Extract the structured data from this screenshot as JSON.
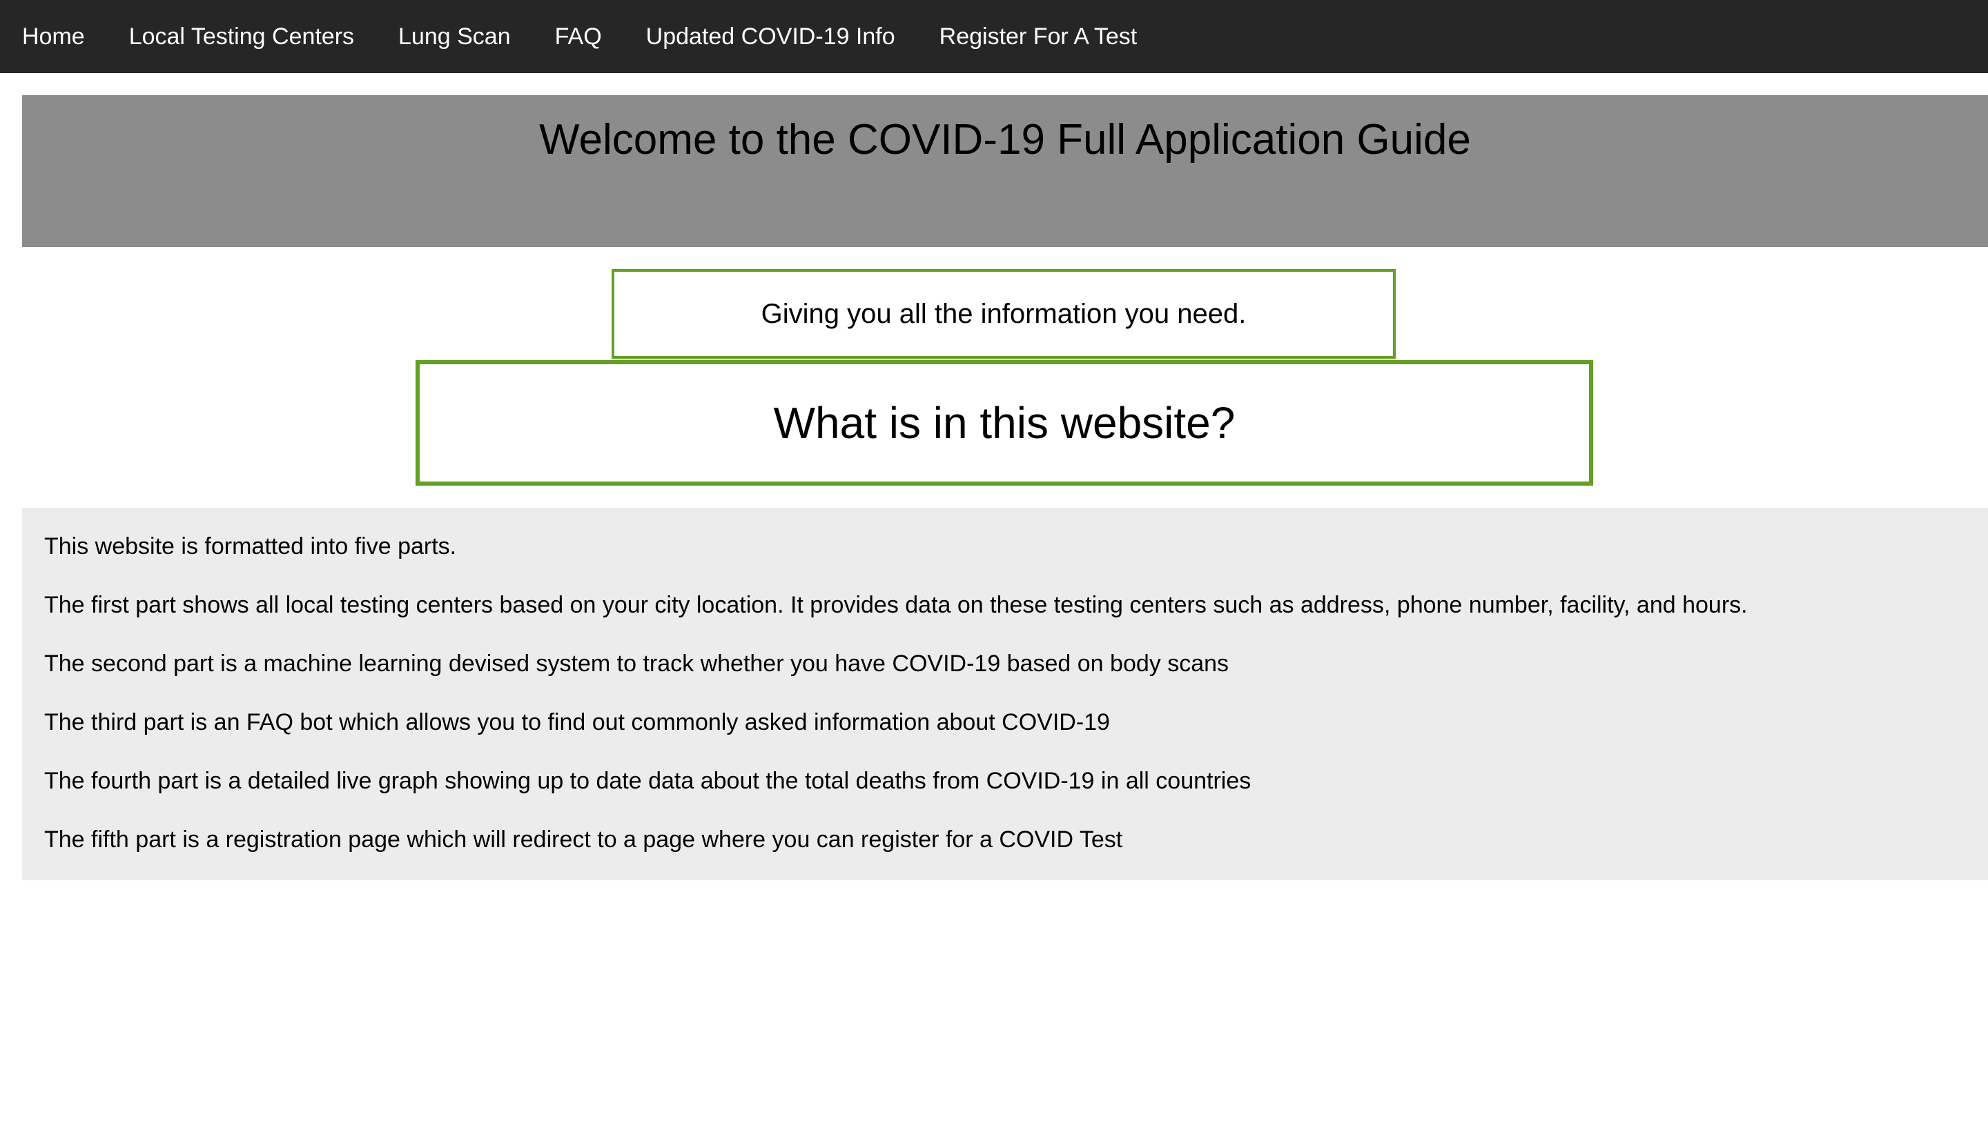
{
  "nav": {
    "items": [
      {
        "label": "Home"
      },
      {
        "label": "Local Testing Centers"
      },
      {
        "label": "Lung Scan"
      },
      {
        "label": "FAQ"
      },
      {
        "label": "Updated COVID-19 Info"
      },
      {
        "label": "Register For A Test"
      }
    ]
  },
  "banner": {
    "title": "Welcome to the COVID-19 Full Application Guide"
  },
  "tagline": {
    "text": "Giving you all the information you need."
  },
  "section": {
    "heading": "What is in this website?"
  },
  "info": {
    "paragraphs": [
      "This website is formatted into five parts.",
      "The first part shows all local testing centers based on your city location. It provides data on these testing centers such as address, phone number, facility, and hours.",
      "The second part is a machine learning devised system to track whether you have COVID-19 based on body scans",
      "The third part is an FAQ bot which allows you to find out commonly asked information about COVID-19",
      "The fourth part is a detailed live graph showing up to date data about the total deaths from COVID-19 in all countries",
      "The fifth part is a registration page which will redirect to a page where you can register for a COVID Test"
    ]
  },
  "colors": {
    "nav_background": "#262626",
    "banner_background": "#8c8c8c",
    "accent_border": "#63a024",
    "info_background": "#ececec"
  }
}
